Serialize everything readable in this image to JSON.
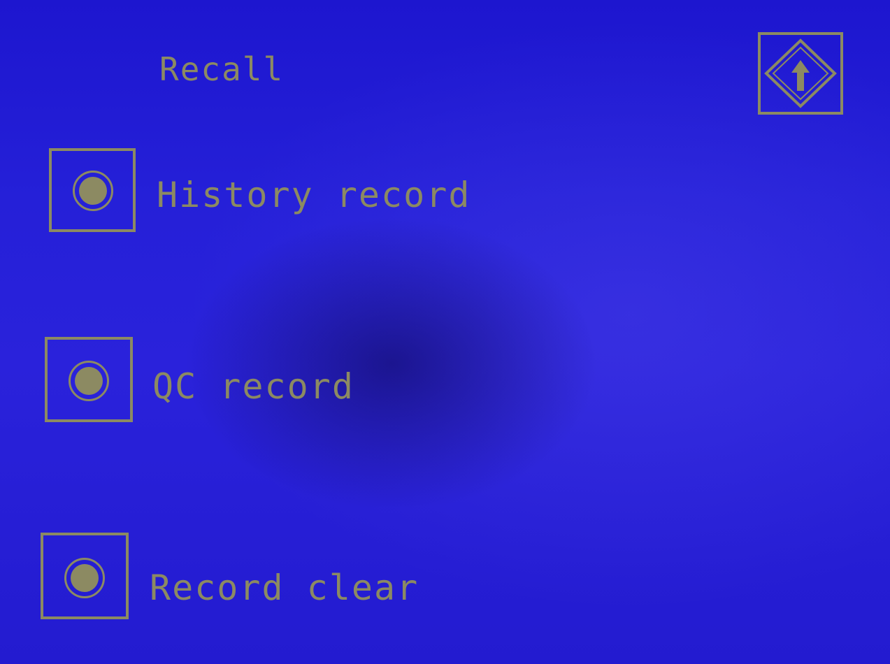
{
  "screen": {
    "title": "Recall"
  },
  "header": {
    "back_icon": "up-arrow-icon"
  },
  "menu": {
    "options": [
      {
        "label": "History record",
        "icon": "radio-button-icon"
      },
      {
        "label": "QC record",
        "icon": "radio-button-icon"
      },
      {
        "label": "Record clear",
        "icon": "radio-button-icon"
      }
    ]
  },
  "colors": {
    "background": "#2a22db",
    "foreground": "#8c8a62"
  }
}
